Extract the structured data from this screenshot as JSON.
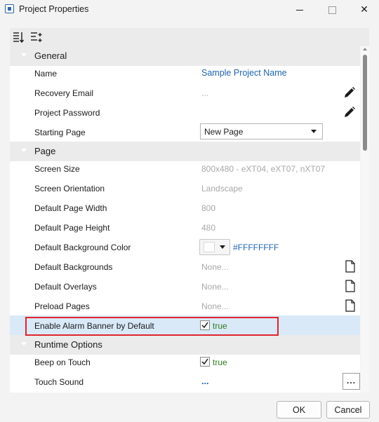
{
  "window": {
    "title": "Project Properties",
    "icon": "app-icon",
    "controls": [
      "minimize-icon",
      "maximize-icon",
      "close-icon"
    ]
  },
  "toolbar": {
    "icons": [
      "categorized-sort-icon",
      "alphabetical-sort-icon"
    ]
  },
  "categories": {
    "general": "General",
    "page": "Page",
    "runtime": "Runtime Options"
  },
  "general": {
    "name": {
      "label": "Name",
      "value": "Sample Project Name"
    },
    "recovery_email": {
      "label": "Recovery Email",
      "value": "..."
    },
    "project_password": {
      "label": "Project Password"
    },
    "starting_page": {
      "label": "Starting Page",
      "value": "New Page"
    }
  },
  "page": {
    "screen_size": {
      "label": "Screen Size",
      "value": "800x480 - eXT04, eXT07, nXT07"
    },
    "screen_orientation": {
      "label": "Screen Orientation",
      "value": "Landscape"
    },
    "default_page_width": {
      "label": "Default Page Width",
      "value": "800"
    },
    "default_page_height": {
      "label": "Default Page Height",
      "value": "480"
    },
    "default_background_color": {
      "label": "Default Background Color",
      "value": "#FFFFFFFF",
      "swatch": "#FFFFFF"
    },
    "default_backgrounds": {
      "label": "Default Backgrounds",
      "value": "None..."
    },
    "default_overlays": {
      "label": "Default Overlays",
      "value": "None..."
    },
    "preload_pages": {
      "label": "Preload Pages",
      "value": "None..."
    },
    "enable_alarm_banner": {
      "label": "Enable Alarm Banner by Default",
      "value": "true",
      "checked": true
    }
  },
  "runtime": {
    "beep_on_touch": {
      "label": "Beep on Touch",
      "value": "true",
      "checked": true
    },
    "touch_sound": {
      "label": "Touch Sound",
      "value": "...",
      "button": "..."
    }
  },
  "footer": {
    "ok": "OK",
    "cancel": "Cancel"
  },
  "colors": {
    "link_blue": "#1E63B0",
    "true_green": "#2E7D1E",
    "highlight_red": "#E0242C",
    "selected_row": "#D9E9F7"
  }
}
